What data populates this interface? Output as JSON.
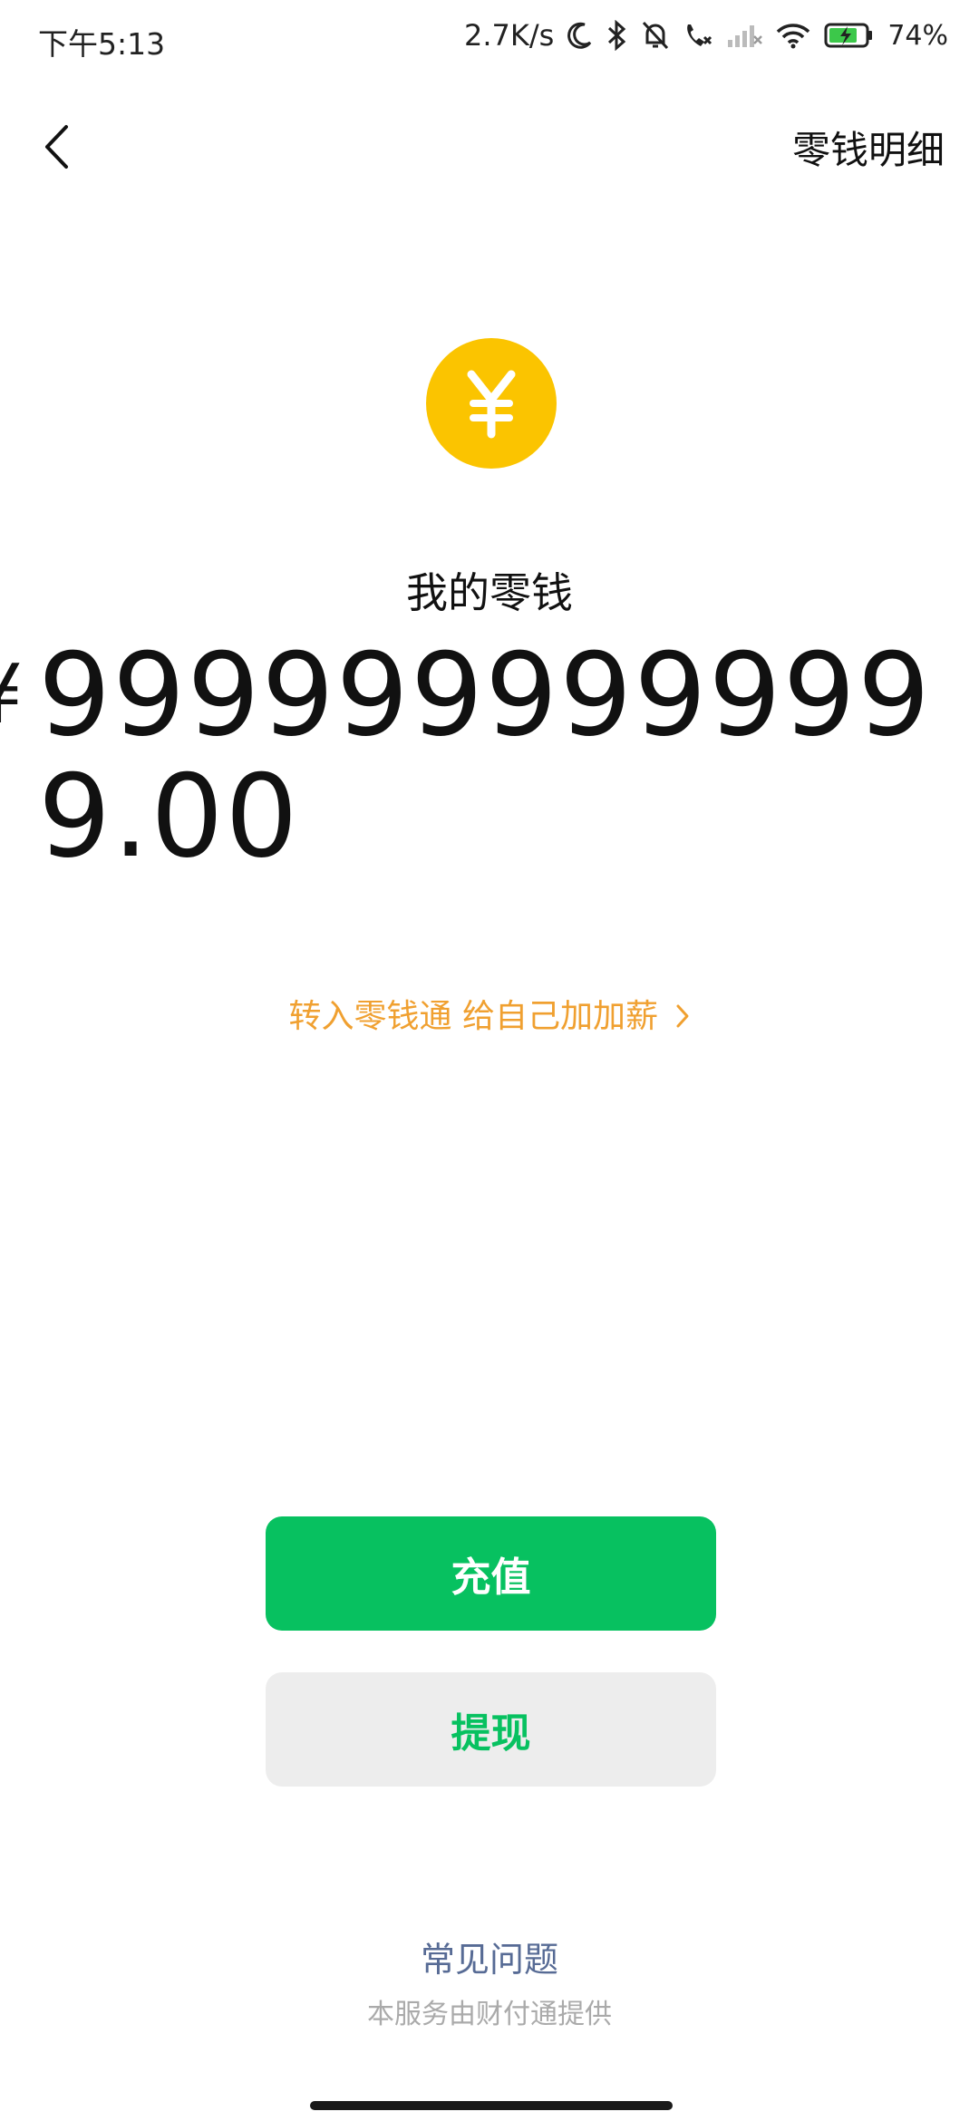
{
  "status_bar": {
    "time": "下午5:13",
    "network_speed": "2.7K/s",
    "battery_percent": "74%",
    "icons": [
      "moon-icon",
      "bluetooth-icon",
      "bell-off-icon",
      "call-icon",
      "signal-icon",
      "wifi-icon",
      "battery-charging-icon"
    ]
  },
  "nav": {
    "back_icon": "chevron-left-icon",
    "detail_label": "零钱明细"
  },
  "balance": {
    "coin_icon": "yuan-coin-icon",
    "title": "我的零钱",
    "currency_symbol": "¥",
    "amount": "9999999999999.00"
  },
  "promo": {
    "text": "转入零钱通 给自己加加薪"
  },
  "actions": {
    "recharge_label": "充值",
    "withdraw_label": "提现"
  },
  "footer": {
    "faq_label": "常见问题",
    "provider_text": "本服务由财付通提供"
  },
  "colors": {
    "primary_green": "#07c160",
    "coin_yellow": "#fbc400",
    "promo_orange": "#f0a030",
    "link_blue": "#576b95"
  }
}
